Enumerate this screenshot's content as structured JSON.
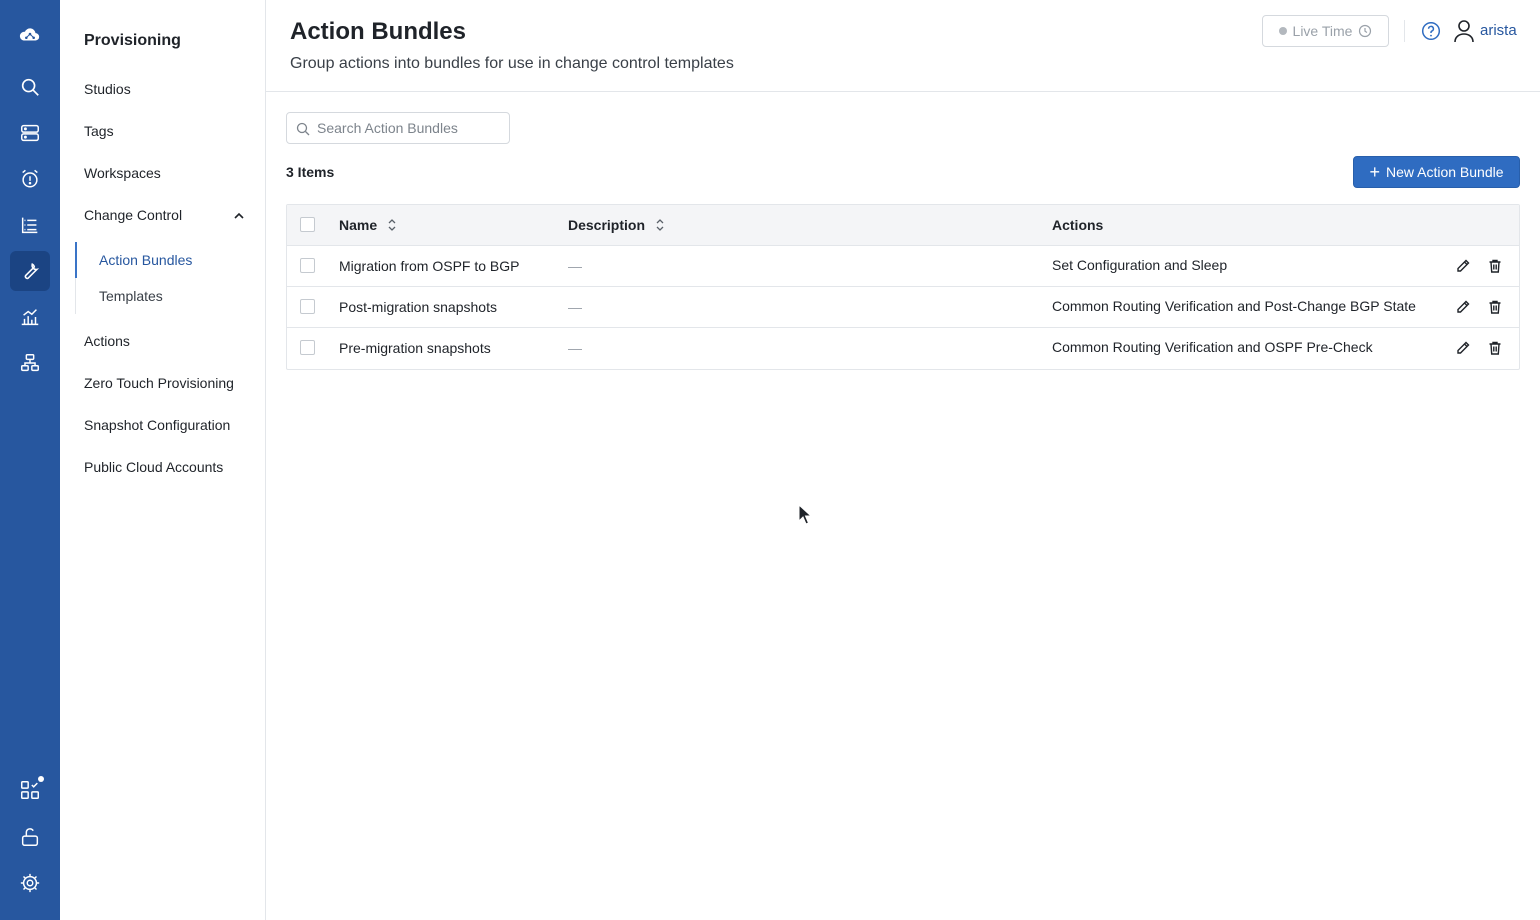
{
  "rail": {
    "top": [
      "cloud-logo-icon",
      "search-icon",
      "devices-icon",
      "events-alarm-icon",
      "tasks-list-icon",
      "provisioning-wrench-icon",
      "dashboards-chart-icon",
      "topology-icon"
    ],
    "bottom": [
      "apps-grid-icon",
      "unlock-icon",
      "settings-gear-icon"
    ],
    "active": "provisioning-wrench-icon"
  },
  "subnav": {
    "title": "Provisioning",
    "items": [
      {
        "label": "Studios"
      },
      {
        "label": "Tags"
      },
      {
        "label": "Workspaces"
      },
      {
        "label": "Change Control"
      },
      {
        "label": "Actions"
      },
      {
        "label": "Zero Touch Provisioning"
      },
      {
        "label": "Snapshot Configuration"
      },
      {
        "label": "Public Cloud Accounts"
      }
    ],
    "change_control_children": [
      {
        "label": "Action Bundles",
        "active": true
      },
      {
        "label": "Templates",
        "active": false
      }
    ]
  },
  "header": {
    "title": "Action Bundles",
    "subtitle": "Group actions into bundles for use in change control templates",
    "live_time_label": "Live Time",
    "user_name": "arista"
  },
  "search": {
    "placeholder": "Search Action Bundles",
    "value": ""
  },
  "list": {
    "count_label": "3 Items",
    "new_button_label": "New Action Bundle",
    "columns": [
      "Name",
      "Description",
      "Actions"
    ],
    "rows": [
      {
        "name": "Migration from OSPF to BGP",
        "description": "—",
        "actions": "Set Configuration and Sleep"
      },
      {
        "name": "Post-migration snapshots",
        "description": "—",
        "actions": "Common Routing Verification and Post-Change BGP State"
      },
      {
        "name": "Pre-migration snapshots",
        "description": "—",
        "actions": "Common Routing Verification and OSPF Pre-Check"
      }
    ]
  },
  "colors": {
    "rail_bg": "#27579f",
    "rail_active": "#1b4483",
    "accent": "#2f6cc1",
    "link": "#27579f"
  }
}
